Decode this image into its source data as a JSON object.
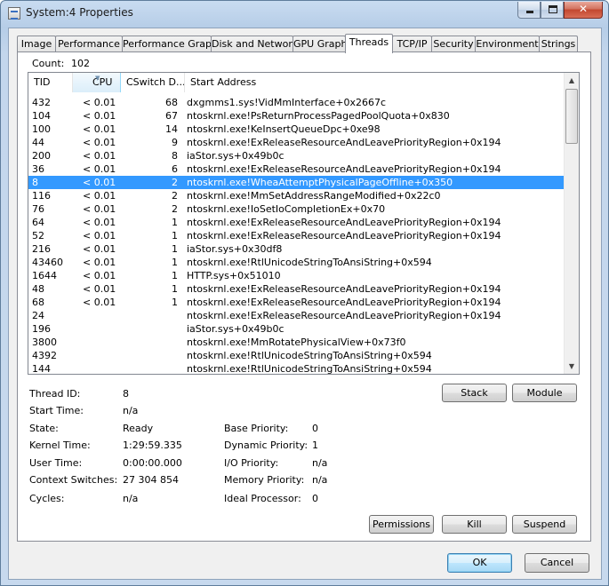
{
  "window": {
    "title": "System:4 Properties"
  },
  "caption": {
    "minimize": "–",
    "maximize": "□",
    "close": "✕"
  },
  "tabs": [
    "Image",
    "Performance",
    "Performance Graph",
    "Disk and Network",
    "GPU Graph",
    "Threads",
    "TCP/IP",
    "Security",
    "Environment",
    "Strings"
  ],
  "active_tab": "Threads",
  "count": {
    "label": "Count:",
    "value": "102"
  },
  "columns": {
    "tid": "TID",
    "cpu": "CPU",
    "cswitch": "CSwitch D...",
    "address": "Start Address"
  },
  "threads": [
    {
      "tid": "432",
      "cpu": "< 0.01",
      "cs": "68",
      "addr": "dxgmms1.sys!VidMmInterface+0x2667c"
    },
    {
      "tid": "104",
      "cpu": "< 0.01",
      "cs": "67",
      "addr": "ntoskrnl.exe!PsReturnProcessPagedPoolQuota+0x830"
    },
    {
      "tid": "100",
      "cpu": "< 0.01",
      "cs": "14",
      "addr": "ntoskrnl.exe!KeInsertQueueDpc+0xe98"
    },
    {
      "tid": "44",
      "cpu": "< 0.01",
      "cs": "9",
      "addr": "ntoskrnl.exe!ExReleaseResourceAndLeavePriorityRegion+0x194"
    },
    {
      "tid": "200",
      "cpu": "< 0.01",
      "cs": "8",
      "addr": "iaStor.sys+0x49b0c"
    },
    {
      "tid": "36",
      "cpu": "< 0.01",
      "cs": "6",
      "addr": "ntoskrnl.exe!ExReleaseResourceAndLeavePriorityRegion+0x194"
    },
    {
      "tid": "8",
      "cpu": "< 0.01",
      "cs": "2",
      "addr": "ntoskrnl.exe!WheaAttemptPhysicalPageOffline+0x350"
    },
    {
      "tid": "116",
      "cpu": "< 0.01",
      "cs": "2",
      "addr": "ntoskrnl.exe!MmSetAddressRangeModified+0x22c0"
    },
    {
      "tid": "76",
      "cpu": "< 0.01",
      "cs": "2",
      "addr": "ntoskrnl.exe!IoSetIoCompletionEx+0x70"
    },
    {
      "tid": "64",
      "cpu": "< 0.01",
      "cs": "1",
      "addr": "ntoskrnl.exe!ExReleaseResourceAndLeavePriorityRegion+0x194"
    },
    {
      "tid": "52",
      "cpu": "< 0.01",
      "cs": "1",
      "addr": "ntoskrnl.exe!ExReleaseResourceAndLeavePriorityRegion+0x194"
    },
    {
      "tid": "216",
      "cpu": "< 0.01",
      "cs": "1",
      "addr": "iaStor.sys+0x30df8"
    },
    {
      "tid": "43460",
      "cpu": "< 0.01",
      "cs": "1",
      "addr": "ntoskrnl.exe!RtlUnicodeStringToAnsiString+0x594"
    },
    {
      "tid": "1644",
      "cpu": "< 0.01",
      "cs": "1",
      "addr": "HTTP.sys+0x51010"
    },
    {
      "tid": "48",
      "cpu": "< 0.01",
      "cs": "1",
      "addr": "ntoskrnl.exe!ExReleaseResourceAndLeavePriorityRegion+0x194"
    },
    {
      "tid": "68",
      "cpu": "< 0.01",
      "cs": "1",
      "addr": "ntoskrnl.exe!ExReleaseResourceAndLeavePriorityRegion+0x194"
    },
    {
      "tid": "24",
      "cpu": "",
      "cs": "",
      "addr": "ntoskrnl.exe!ExReleaseResourceAndLeavePriorityRegion+0x194"
    },
    {
      "tid": "196",
      "cpu": "",
      "cs": "",
      "addr": "iaStor.sys+0x49b0c"
    },
    {
      "tid": "3800",
      "cpu": "",
      "cs": "",
      "addr": "ntoskrnl.exe!MmRotatePhysicalView+0x73f0"
    },
    {
      "tid": "4392",
      "cpu": "",
      "cs": "",
      "addr": "ntoskrnl.exe!RtlUnicodeStringToAnsiString+0x594"
    },
    {
      "tid": "144",
      "cpu": "",
      "cs": "",
      "addr": "ntoskrnl.exe!RtlUnicodeStringToAnsiString+0x594"
    }
  ],
  "selected_tid": "8",
  "buttons": {
    "stack": "Stack",
    "module": "Module",
    "permissions": "Permissions",
    "kill": "Kill",
    "suspend": "Suspend",
    "ok": "OK",
    "cancel": "Cancel"
  },
  "details": {
    "thread_id": {
      "label": "Thread ID:",
      "value": "8"
    },
    "start_time": {
      "label": "Start Time:",
      "value": "n/a"
    },
    "state": {
      "label": "State:",
      "value": "Ready"
    },
    "kernel_time": {
      "label": "Kernel Time:",
      "value": "1:29:59.335"
    },
    "user_time": {
      "label": "User Time:",
      "value": "0:00:00.000"
    },
    "context_switches": {
      "label": "Context Switches:",
      "value": "27 304 854"
    },
    "cycles": {
      "label": "Cycles:",
      "value": "n/a"
    },
    "base_priority": {
      "label": "Base Priority:",
      "value": "0"
    },
    "dynamic_priority": {
      "label": "Dynamic Priority:",
      "value": "1"
    },
    "io_priority": {
      "label": "I/O Priority:",
      "value": "n/a"
    },
    "memory_priority": {
      "label": "Memory Priority:",
      "value": "n/a"
    },
    "ideal_processor": {
      "label": "Ideal Processor:",
      "value": "0"
    }
  }
}
